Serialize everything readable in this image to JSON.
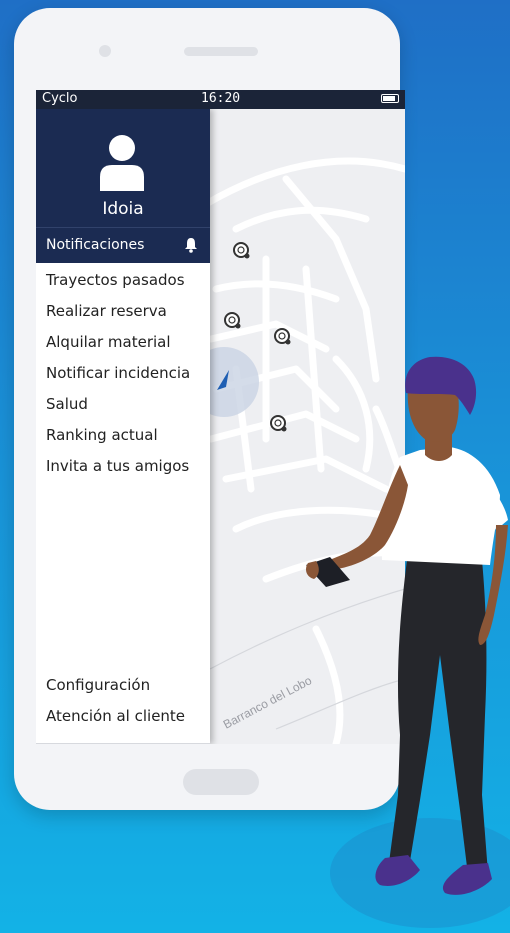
{
  "statusbar": {
    "app_name": "Cyclo",
    "time": "16:20"
  },
  "drawer": {
    "username": "Idoia",
    "notifications_label": "Notificaciones",
    "items": [
      {
        "label": "Trayectos pasados"
      },
      {
        "label": "Realizar reserva"
      },
      {
        "label": "Alquilar material"
      },
      {
        "label": "Notificar incidencia"
      },
      {
        "label": "Salud"
      },
      {
        "label": "Ranking actual"
      },
      {
        "label": "Invita a tus amigos"
      }
    ],
    "footer_items": [
      {
        "label": "Configuración"
      },
      {
        "label": "Atención al cliente"
      }
    ]
  },
  "map": {
    "street_label": "Barranco del Lobo"
  },
  "icons": [
    "user-avatar-icon",
    "bell-icon",
    "bike-station-icon",
    "location-arrow-icon",
    "battery-icon"
  ],
  "colors": {
    "background": "#1a8fd6",
    "drawer_header": "#1b2b52",
    "statusbar": "#1b2438",
    "map_bg": "#eeeff2"
  }
}
